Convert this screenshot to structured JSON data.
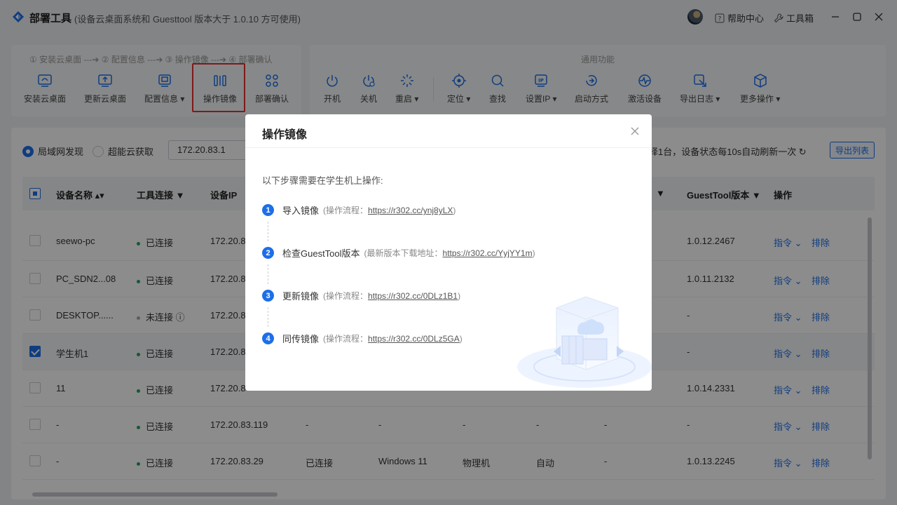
{
  "titlebar": {
    "title": "部署工具",
    "subtitle": "(设备云桌面系统和 Guesttool 版本大于 1.0.10 方可使用)",
    "help": "帮助中心",
    "toolbox": "工具箱"
  },
  "toolbar": {
    "steps": "① 安装云桌面 ---➔ ② 配置信息 ---➔ ③ 操作镜像 ---➔ ④ 部署确认",
    "left_tools": [
      "安装云桌面",
      "更新云桌面",
      "配置信息 ▾",
      "操作镜像",
      "部署确认"
    ],
    "common_title": "通用功能",
    "right_tools": [
      "开机",
      "关机",
      "重启 ▾",
      "定位 ▾",
      "查找",
      "设置IP ▾",
      "启动方式",
      "激活设备",
      "导出日志 ▾",
      "更多操作 ▾"
    ]
  },
  "filter": {
    "radio_lan": "局域网发现",
    "radio_cloud": "超能云获取",
    "ip_value": "172.20.83.1",
    "refresh_note": "择1台，设备状态每10s自动刷新一次 ↻",
    "export_button": "导出列表"
  },
  "table": {
    "headers": {
      "name": "设备名称 ▴▾",
      "tool": "工具连接 ▼",
      "ip": "设备IP",
      "col_hidden": "▼",
      "gt": "GuestTool版本 ▼",
      "action": "操作"
    },
    "action_cmd": "指令 ⌄",
    "action_del": "排除",
    "rows": [
      {
        "name": "seewo-pc",
        "tool": "已连接",
        "ip": "172.20.8",
        "c4": "",
        "c5": "",
        "c6": "",
        "c7": "",
        "c8": "",
        "gt": "1.0.12.2467",
        "action": true,
        "checked": false,
        "online": true
      },
      {
        "name": "PC_SDN2...08",
        "tool": "已连接",
        "ip": "172.20.8",
        "c4": "",
        "c5": "",
        "c6": "",
        "c7": "",
        "c8": "",
        "gt": "1.0.11.2132",
        "action": true,
        "checked": false,
        "online": true
      },
      {
        "name": "DESKTOP......",
        "tool": "未连接 ⓘ",
        "ip": "172.20.8",
        "c4": "",
        "c5": "",
        "c6": "",
        "c7": "",
        "c8": "",
        "gt": "-",
        "action": true,
        "checked": false,
        "online": false
      },
      {
        "name": "学生机1",
        "tool": "已连接",
        "ip": "172.20.8",
        "c4": "",
        "c5": "",
        "c6": "",
        "c7": "",
        "c8": "",
        "gt": "-",
        "action": true,
        "checked": true,
        "online": true
      },
      {
        "name": "11",
        "tool": "已连接",
        "ip": "172.20.8",
        "c4": "",
        "c5": "",
        "c6": "",
        "c7": "",
        "c8": "",
        "gt": "1.0.14.2331",
        "action": true,
        "checked": false,
        "online": true
      },
      {
        "name": "-",
        "tool": "已连接",
        "ip": "172.20.83.119",
        "c4": "-",
        "c5": "-",
        "c6": "-",
        "c7": "-",
        "c8": "-",
        "gt": "-",
        "action": true,
        "checked": false,
        "online": true
      },
      {
        "name": "-",
        "tool": "已连接",
        "ip": "172.20.83.29",
        "c4": "已连接",
        "c5": "Windows 11",
        "c6": "物理机",
        "c7": "自动",
        "c8": "-",
        "gt": "1.0.13.2245",
        "action": true,
        "checked": false,
        "online": true
      }
    ]
  },
  "dialog": {
    "title": "操作镜像",
    "intro": "以下步骤需要在学生机上操作:",
    "steps": [
      {
        "num": "1",
        "title": "导入镜像",
        "note_prefix": "(操作流程：",
        "url": "https://r302.cc/ynj8yLX",
        "note_suffix": ")"
      },
      {
        "num": "2",
        "title": "检查GuestTool版本",
        "note_prefix": "(最新版本下载地址：",
        "url": "https://r302.cc/YyjYY1m",
        "note_suffix": ")"
      },
      {
        "num": "3",
        "title": "更新镜像",
        "note_prefix": "(操作流程：",
        "url": "https://r302.cc/0DLz1B1",
        "note_suffix": ")"
      },
      {
        "num": "4",
        "title": "同传镜像",
        "note_prefix": "(操作流程：",
        "url": "https://r302.cc/0DLz5GA",
        "note_suffix": ")"
      }
    ]
  },
  "colors": {
    "accent": "#1d6fe8",
    "highlight": "#e5302f",
    "online": "#22a55b"
  }
}
